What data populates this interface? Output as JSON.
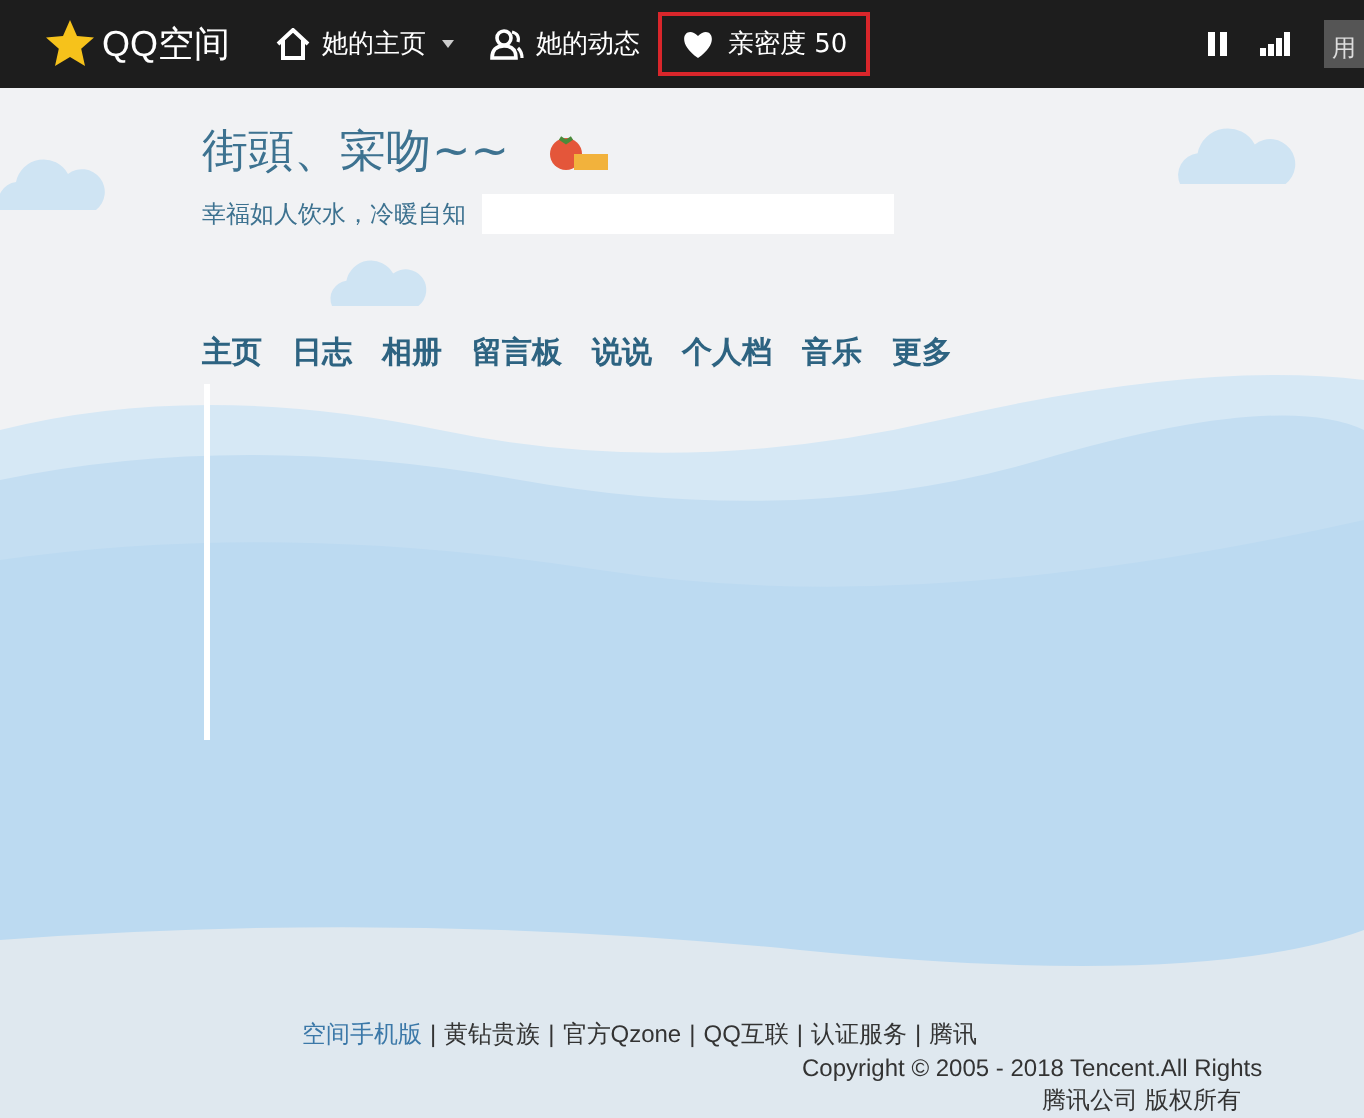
{
  "topbar": {
    "logo": "QQ空间",
    "items": [
      {
        "kind": "home",
        "label": "她的主页",
        "dropdown": true,
        "highlighted": false
      },
      {
        "kind": "people",
        "label": "她的动态",
        "dropdown": false,
        "highlighted": false
      },
      {
        "kind": "heart",
        "label": "亲密度 50",
        "dropdown": false,
        "highlighted": true
      }
    ],
    "right_button": "用"
  },
  "profile": {
    "title": "街頭、寀吻~~",
    "motto": "幸福如人饮水，冷暖自知"
  },
  "nav": [
    "主页",
    "日志",
    "相册",
    "留言板",
    "说说",
    "个人档",
    "音乐",
    "更多"
  ],
  "footer": {
    "links": [
      {
        "label": "空间手机版",
        "kind": "link"
      },
      {
        "label": "|",
        "kind": "separator"
      },
      {
        "label": "黄钻贵族",
        "kind": "plain"
      },
      {
        "label": "|",
        "kind": "separator"
      },
      {
        "label": "官方Qzone",
        "kind": "plain"
      },
      {
        "label": "|",
        "kind": "separator"
      },
      {
        "label": "QQ互联",
        "kind": "plain"
      },
      {
        "label": "|",
        "kind": "separator"
      },
      {
        "label": "认证服务",
        "kind": "plain"
      },
      {
        "label": "|",
        "kind": "separator"
      },
      {
        "label": "腾讯",
        "kind": "plain"
      }
    ],
    "copyright": "Copyright © 2005 - 2018 Tencent.All Rights",
    "company": "腾讯公司 版权所有"
  }
}
